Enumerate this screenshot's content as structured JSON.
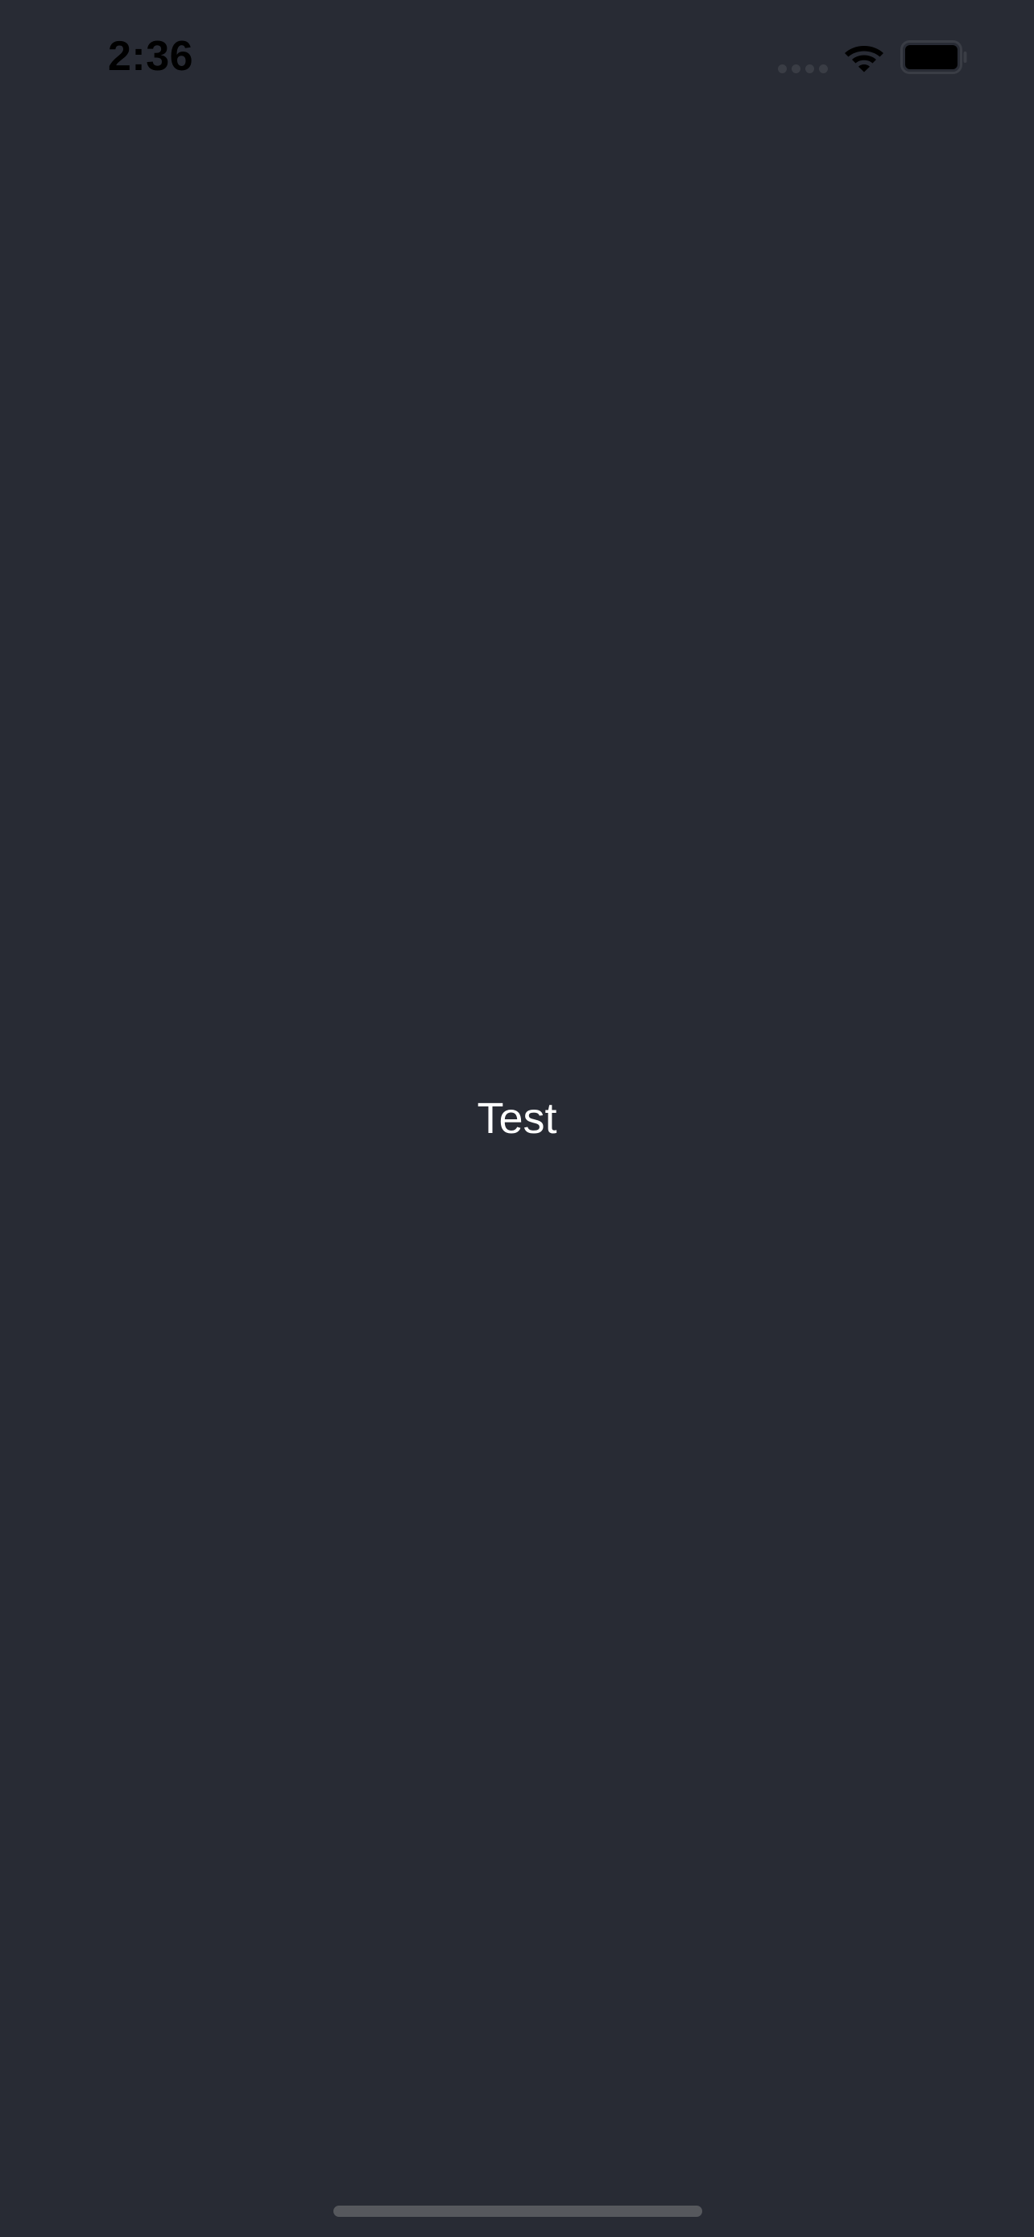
{
  "status_bar": {
    "time": "2:36",
    "icons": [
      "signal-icon",
      "wifi-icon",
      "battery-icon"
    ]
  },
  "main": {
    "label": "Test"
  },
  "colors": {
    "background": "#282b34",
    "status_text": "#000000",
    "label_text": "#ffffff",
    "home_indicator": "#56585d"
  }
}
